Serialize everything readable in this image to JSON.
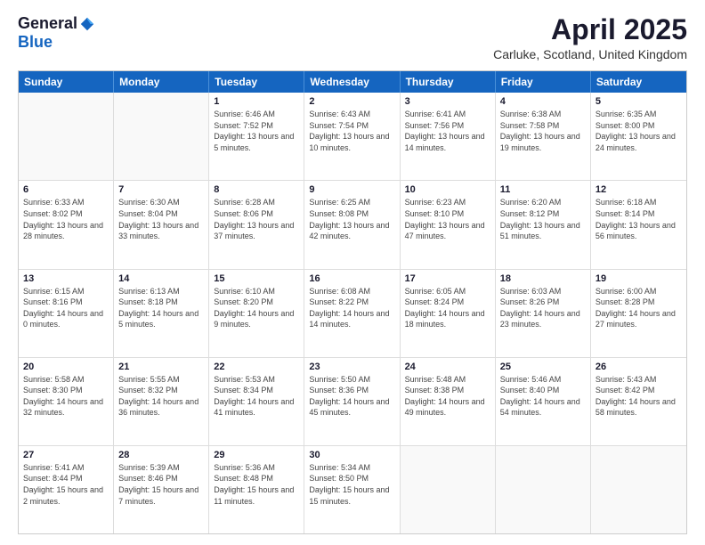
{
  "logo": {
    "general": "General",
    "blue": "Blue"
  },
  "title": "April 2025",
  "subtitle": "Carluke, Scotland, United Kingdom",
  "days_of_week": [
    "Sunday",
    "Monday",
    "Tuesday",
    "Wednesday",
    "Thursday",
    "Friday",
    "Saturday"
  ],
  "weeks": [
    [
      {
        "day": "",
        "info": ""
      },
      {
        "day": "",
        "info": ""
      },
      {
        "day": "1",
        "info": "Sunrise: 6:46 AM\nSunset: 7:52 PM\nDaylight: 13 hours and 5 minutes."
      },
      {
        "day": "2",
        "info": "Sunrise: 6:43 AM\nSunset: 7:54 PM\nDaylight: 13 hours and 10 minutes."
      },
      {
        "day": "3",
        "info": "Sunrise: 6:41 AM\nSunset: 7:56 PM\nDaylight: 13 hours and 14 minutes."
      },
      {
        "day": "4",
        "info": "Sunrise: 6:38 AM\nSunset: 7:58 PM\nDaylight: 13 hours and 19 minutes."
      },
      {
        "day": "5",
        "info": "Sunrise: 6:35 AM\nSunset: 8:00 PM\nDaylight: 13 hours and 24 minutes."
      }
    ],
    [
      {
        "day": "6",
        "info": "Sunrise: 6:33 AM\nSunset: 8:02 PM\nDaylight: 13 hours and 28 minutes."
      },
      {
        "day": "7",
        "info": "Sunrise: 6:30 AM\nSunset: 8:04 PM\nDaylight: 13 hours and 33 minutes."
      },
      {
        "day": "8",
        "info": "Sunrise: 6:28 AM\nSunset: 8:06 PM\nDaylight: 13 hours and 37 minutes."
      },
      {
        "day": "9",
        "info": "Sunrise: 6:25 AM\nSunset: 8:08 PM\nDaylight: 13 hours and 42 minutes."
      },
      {
        "day": "10",
        "info": "Sunrise: 6:23 AM\nSunset: 8:10 PM\nDaylight: 13 hours and 47 minutes."
      },
      {
        "day": "11",
        "info": "Sunrise: 6:20 AM\nSunset: 8:12 PM\nDaylight: 13 hours and 51 minutes."
      },
      {
        "day": "12",
        "info": "Sunrise: 6:18 AM\nSunset: 8:14 PM\nDaylight: 13 hours and 56 minutes."
      }
    ],
    [
      {
        "day": "13",
        "info": "Sunrise: 6:15 AM\nSunset: 8:16 PM\nDaylight: 14 hours and 0 minutes."
      },
      {
        "day": "14",
        "info": "Sunrise: 6:13 AM\nSunset: 8:18 PM\nDaylight: 14 hours and 5 minutes."
      },
      {
        "day": "15",
        "info": "Sunrise: 6:10 AM\nSunset: 8:20 PM\nDaylight: 14 hours and 9 minutes."
      },
      {
        "day": "16",
        "info": "Sunrise: 6:08 AM\nSunset: 8:22 PM\nDaylight: 14 hours and 14 minutes."
      },
      {
        "day": "17",
        "info": "Sunrise: 6:05 AM\nSunset: 8:24 PM\nDaylight: 14 hours and 18 minutes."
      },
      {
        "day": "18",
        "info": "Sunrise: 6:03 AM\nSunset: 8:26 PM\nDaylight: 14 hours and 23 minutes."
      },
      {
        "day": "19",
        "info": "Sunrise: 6:00 AM\nSunset: 8:28 PM\nDaylight: 14 hours and 27 minutes."
      }
    ],
    [
      {
        "day": "20",
        "info": "Sunrise: 5:58 AM\nSunset: 8:30 PM\nDaylight: 14 hours and 32 minutes."
      },
      {
        "day": "21",
        "info": "Sunrise: 5:55 AM\nSunset: 8:32 PM\nDaylight: 14 hours and 36 minutes."
      },
      {
        "day": "22",
        "info": "Sunrise: 5:53 AM\nSunset: 8:34 PM\nDaylight: 14 hours and 41 minutes."
      },
      {
        "day": "23",
        "info": "Sunrise: 5:50 AM\nSunset: 8:36 PM\nDaylight: 14 hours and 45 minutes."
      },
      {
        "day": "24",
        "info": "Sunrise: 5:48 AM\nSunset: 8:38 PM\nDaylight: 14 hours and 49 minutes."
      },
      {
        "day": "25",
        "info": "Sunrise: 5:46 AM\nSunset: 8:40 PM\nDaylight: 14 hours and 54 minutes."
      },
      {
        "day": "26",
        "info": "Sunrise: 5:43 AM\nSunset: 8:42 PM\nDaylight: 14 hours and 58 minutes."
      }
    ],
    [
      {
        "day": "27",
        "info": "Sunrise: 5:41 AM\nSunset: 8:44 PM\nDaylight: 15 hours and 2 minutes."
      },
      {
        "day": "28",
        "info": "Sunrise: 5:39 AM\nSunset: 8:46 PM\nDaylight: 15 hours and 7 minutes."
      },
      {
        "day": "29",
        "info": "Sunrise: 5:36 AM\nSunset: 8:48 PM\nDaylight: 15 hours and 11 minutes."
      },
      {
        "day": "30",
        "info": "Sunrise: 5:34 AM\nSunset: 8:50 PM\nDaylight: 15 hours and 15 minutes."
      },
      {
        "day": "",
        "info": ""
      },
      {
        "day": "",
        "info": ""
      },
      {
        "day": "",
        "info": ""
      }
    ]
  ]
}
